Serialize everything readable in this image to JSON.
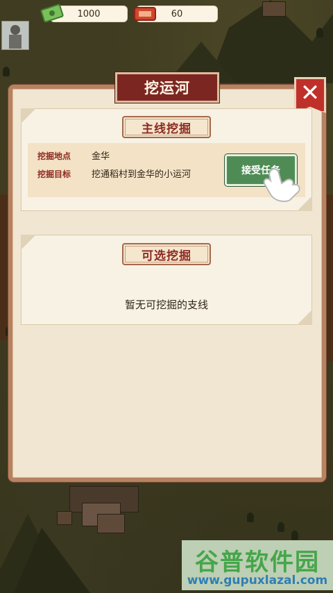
{
  "resources": {
    "money": {
      "icon": "cash-icon",
      "value": "1000"
    },
    "tickets": {
      "icon": "ticket-icon",
      "value": "60"
    }
  },
  "dialog": {
    "title": "挖运河",
    "close_icon": "close-icon",
    "main_section": {
      "label": "主线挖掘",
      "location_label": "挖掘地点",
      "location_value": "金华",
      "goal_label": "挖掘目标",
      "goal_value": "挖通稻村到金华的小运河",
      "accept_button": "接受任务"
    },
    "optional_section": {
      "label": "可选挖掘",
      "empty_text": "暂无可挖掘的支线"
    }
  },
  "watermark": {
    "title": "谷普软件园",
    "url": "www.gupuxlazal.com"
  },
  "colors": {
    "title_plate": "#7c2622",
    "close_button": "#c0302a",
    "accept_button": "#4f8c55",
    "panel": "#f0e6d2",
    "frame": "#b78262"
  }
}
